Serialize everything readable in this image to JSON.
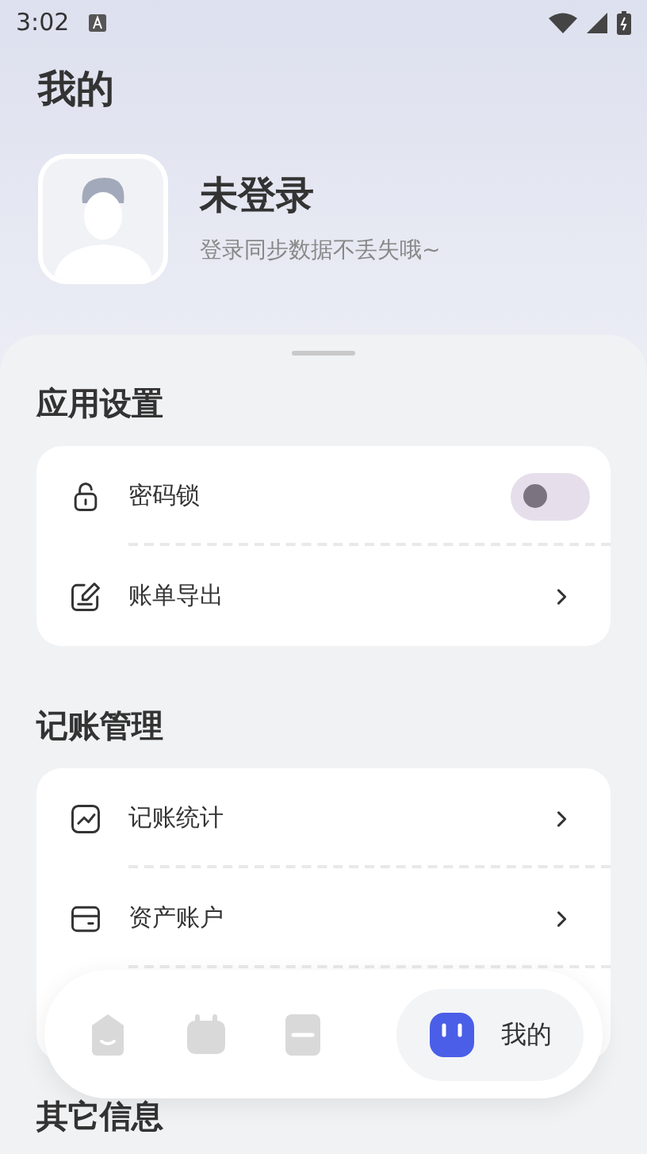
{
  "status_bar": {
    "time": "3:02"
  },
  "title": "我的",
  "profile": {
    "name": "未登录",
    "hint": "登录同步数据不丢失哦~"
  },
  "sections": [
    {
      "heading": "应用设置",
      "items": [
        {
          "kind": "toggle",
          "label": "密码锁",
          "on": false
        },
        {
          "kind": "link",
          "label": "账单导出"
        }
      ]
    },
    {
      "heading": "记账管理",
      "items": [
        {
          "kind": "link",
          "label": "记账统计"
        },
        {
          "kind": "link",
          "label": "资产账户"
        }
      ]
    },
    {
      "heading": "其它信息"
    }
  ],
  "bottom_nav": [
    {
      "selected": false
    },
    {
      "selected": false
    },
    {
      "selected": false
    },
    {
      "label": "我的",
      "selected": true
    }
  ]
}
